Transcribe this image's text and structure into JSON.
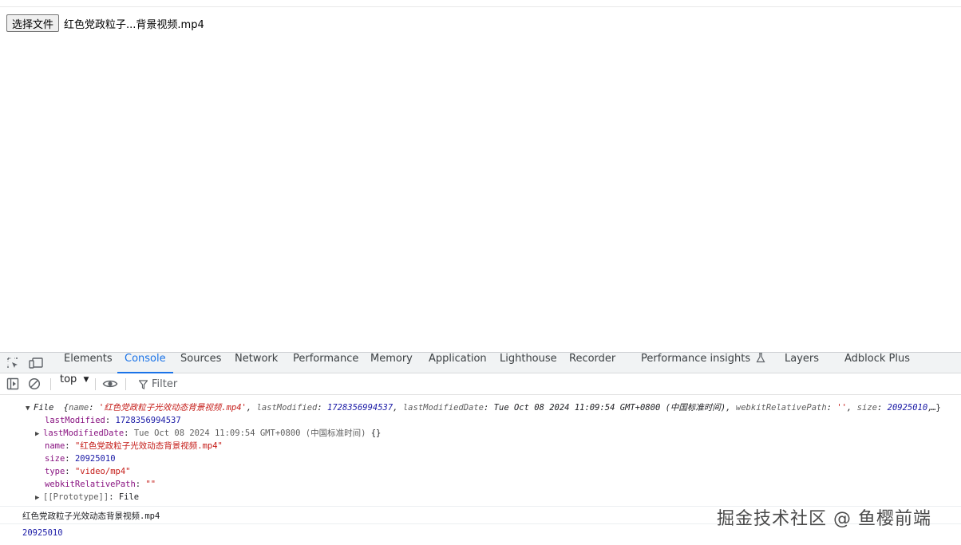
{
  "page": {
    "choose_file_label": "选择文件",
    "file_name": "红色党政粒子...背景视频.mp4"
  },
  "devtools": {
    "tabs": [
      "Elements",
      "Console",
      "Sources",
      "Network",
      "Performance",
      "Memory",
      "Application",
      "Lighthouse",
      "Recorder",
      "Performance insights",
      "Layers",
      "Adblock Plus"
    ],
    "active_tab": "Console",
    "context": "top",
    "filter_placeholder": "Filter"
  },
  "console": {
    "file_object": {
      "type_label": "File",
      "summary": {
        "name_key": "name",
        "name_val": "'红色党政粒子光效动态背景视频.mp4'",
        "lastModified_key": "lastModified",
        "lastModified_val": "1728356994537",
        "lastModifiedDate_key": "lastModifiedDate",
        "lastModifiedDate_val": "Tue Oct 08 2024 11:09:54 GMT+0800 (中国标准时间)",
        "webkit_key": "webkitRelativePath",
        "webkit_val": "''",
        "size_key": "size",
        "size_val": "20925010",
        "ellipsis": "…}"
      },
      "props": {
        "lastModified_key": "lastModified",
        "lastModified_val": "1728356994537",
        "lastModifiedDate_key": "lastModifiedDate",
        "lastModifiedDate_val": "Tue Oct 08 2024 11:09:54 GMT+0800 (中国标准时间)",
        "lastModifiedDate_tail": "{}",
        "name_key": "name",
        "name_val": "\"红色党政粒子光效动态背景视频.mp4\"",
        "size_key": "size",
        "size_val": "20925010",
        "type_key": "type",
        "type_val": "\"video/mp4\"",
        "webkit_key": "webkitRelativePath",
        "webkit_val": "\"\"",
        "proto_key": "[[Prototype]]",
        "proto_val": "File"
      }
    },
    "log_name": "红色党政粒子光效动态背景视频.mp4",
    "log_size": "20925010"
  },
  "watermark": "掘金技术社区 @ 鱼樱前端"
}
